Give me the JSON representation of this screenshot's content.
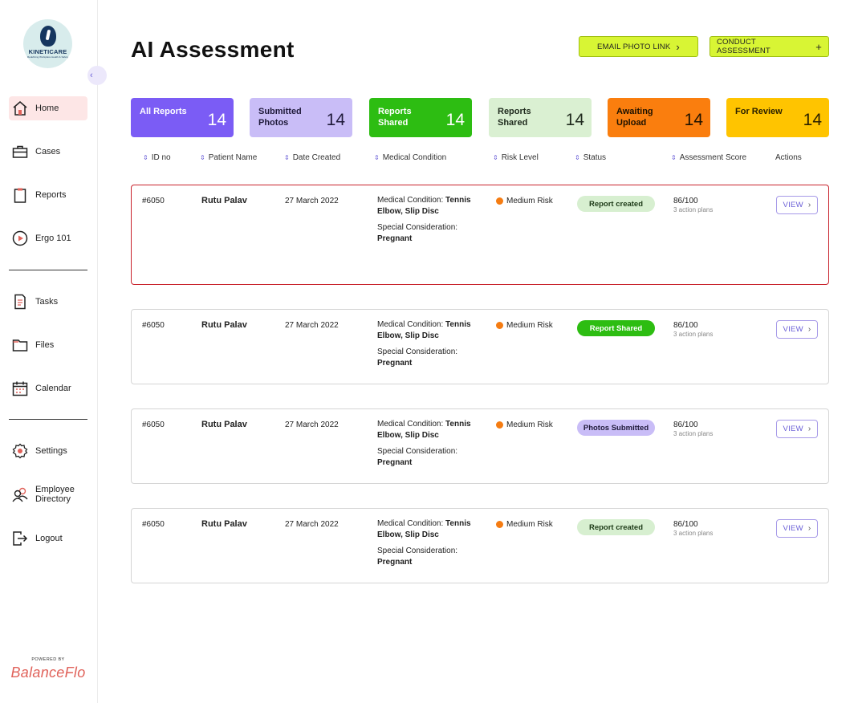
{
  "brand": {
    "logo_text": "KINETICARE",
    "logo_sub": "Redefining Workplace Health & Safety",
    "powered_by": "POWERED BY",
    "powered_name": "BalanceFlo"
  },
  "sidebar": {
    "collapse_glyph": "‹",
    "items": [
      {
        "label": "Home",
        "icon": "home-icon",
        "active": true
      },
      {
        "label": "Cases",
        "icon": "briefcase-icon"
      },
      {
        "label": "Reports",
        "icon": "clipboard-icon"
      },
      {
        "label": "Ergo 101",
        "icon": "play-circle-icon"
      },
      {
        "label": "Tasks",
        "icon": "task-list-icon"
      },
      {
        "label": "Files",
        "icon": "folder-icon"
      },
      {
        "label": "Calendar",
        "icon": "calendar-icon"
      },
      {
        "label": "Settings",
        "icon": "gear-icon"
      },
      {
        "label": "Employee Directory",
        "icon": "people-icon"
      },
      {
        "label": "Logout",
        "icon": "logout-icon"
      }
    ]
  },
  "header": {
    "title": "AI Assessment",
    "email_btn": "EMAIL PHOTO LINK",
    "email_glyph": "›",
    "conduct_btn": "CONDUCT ASSESSMENT",
    "conduct_glyph": "+"
  },
  "stats": [
    {
      "label": "All Reports",
      "count": "14",
      "bg": "#7b5cf5",
      "fg": "#ffffff"
    },
    {
      "label": "Submitted Photos",
      "count": "14",
      "bg": "#c9bdf7",
      "fg": "#1f1a3a"
    },
    {
      "label": "Reports Shared",
      "count": "14",
      "bg": "#2dbd12",
      "fg": "#ffffff"
    },
    {
      "label": "Reports Shared",
      "count": "14",
      "bg": "#daf0d2",
      "fg": "#1f2a1d"
    },
    {
      "label": "Awaiting Upload",
      "count": "14",
      "bg": "#fa7e0e",
      "fg": "#1e1200"
    },
    {
      "label": "For Review",
      "count": "14",
      "bg": "#ffc400",
      "fg": "#2a2000"
    }
  ],
  "table": {
    "sort_glyph": "⇕",
    "columns": [
      "ID no",
      "Patient Name",
      "Date Created",
      "Medical Condition",
      "Risk Level",
      "Status",
      "Assessment Score",
      "Actions"
    ],
    "rows": [
      {
        "id": "#6050",
        "name": "Rutu Palav",
        "date": "27 March 2022",
        "med_label": "Medical Condition: ",
        "med_value": "Tennis Elbow, Slip Disc",
        "special_label": "Special Consideration:",
        "special_value": "Pregnant",
        "risk": "Medium Risk",
        "status": "Report created",
        "status_bg": "#d7efd0",
        "status_fg": "#1d3a17",
        "score": "86/100",
        "score_sub": "3 action plans",
        "view": "VIEW",
        "view_glyph": "›"
      },
      {
        "id": "#6050",
        "name": "Rutu Palav",
        "date": "27 March 2022",
        "med_label": "Medical Condition: ",
        "med_value": "Tennis Elbow, Slip Disc",
        "special_label": "Special Consideration:",
        "special_value": "Pregnant",
        "risk": "Medium Risk",
        "status": "Report Shared",
        "status_bg": "#2dbd12",
        "status_fg": "#ffffff",
        "score": "86/100",
        "score_sub": "3 action plans",
        "view": "VIEW",
        "view_glyph": "›"
      },
      {
        "id": "#6050",
        "name": "Rutu Palav",
        "date": "27 March 2022",
        "med_label": "Medical Condition: ",
        "med_value": "Tennis Elbow, Slip Disc",
        "special_label": "Special Consideration:",
        "special_value": "Pregnant",
        "risk": "Medium Risk",
        "status": "Photos Submitted",
        "status_bg": "#c9bdf7",
        "status_fg": "#1f1a3a",
        "score": "86/100",
        "score_sub": "3 action plans",
        "view": "VIEW",
        "view_glyph": "›"
      },
      {
        "id": "#6050",
        "name": "Rutu Palav",
        "date": "27 March 2022",
        "med_label": "Medical Condition: ",
        "med_value": "Tennis Elbow, Slip Disc",
        "special_label": "Special Consideration:",
        "special_value": "Pregnant",
        "risk": "Medium Risk",
        "status": "Report created",
        "status_bg": "#d7efd0",
        "status_fg": "#1d3a17",
        "score": "86/100",
        "score_sub": "3 action plans",
        "view": "VIEW",
        "view_glyph": "›"
      }
    ]
  },
  "colors": {
    "accent": "#6a5fd7",
    "selected_border": "#c8222b",
    "risk_medium": "#f57c12",
    "cta": "#d8f534"
  }
}
